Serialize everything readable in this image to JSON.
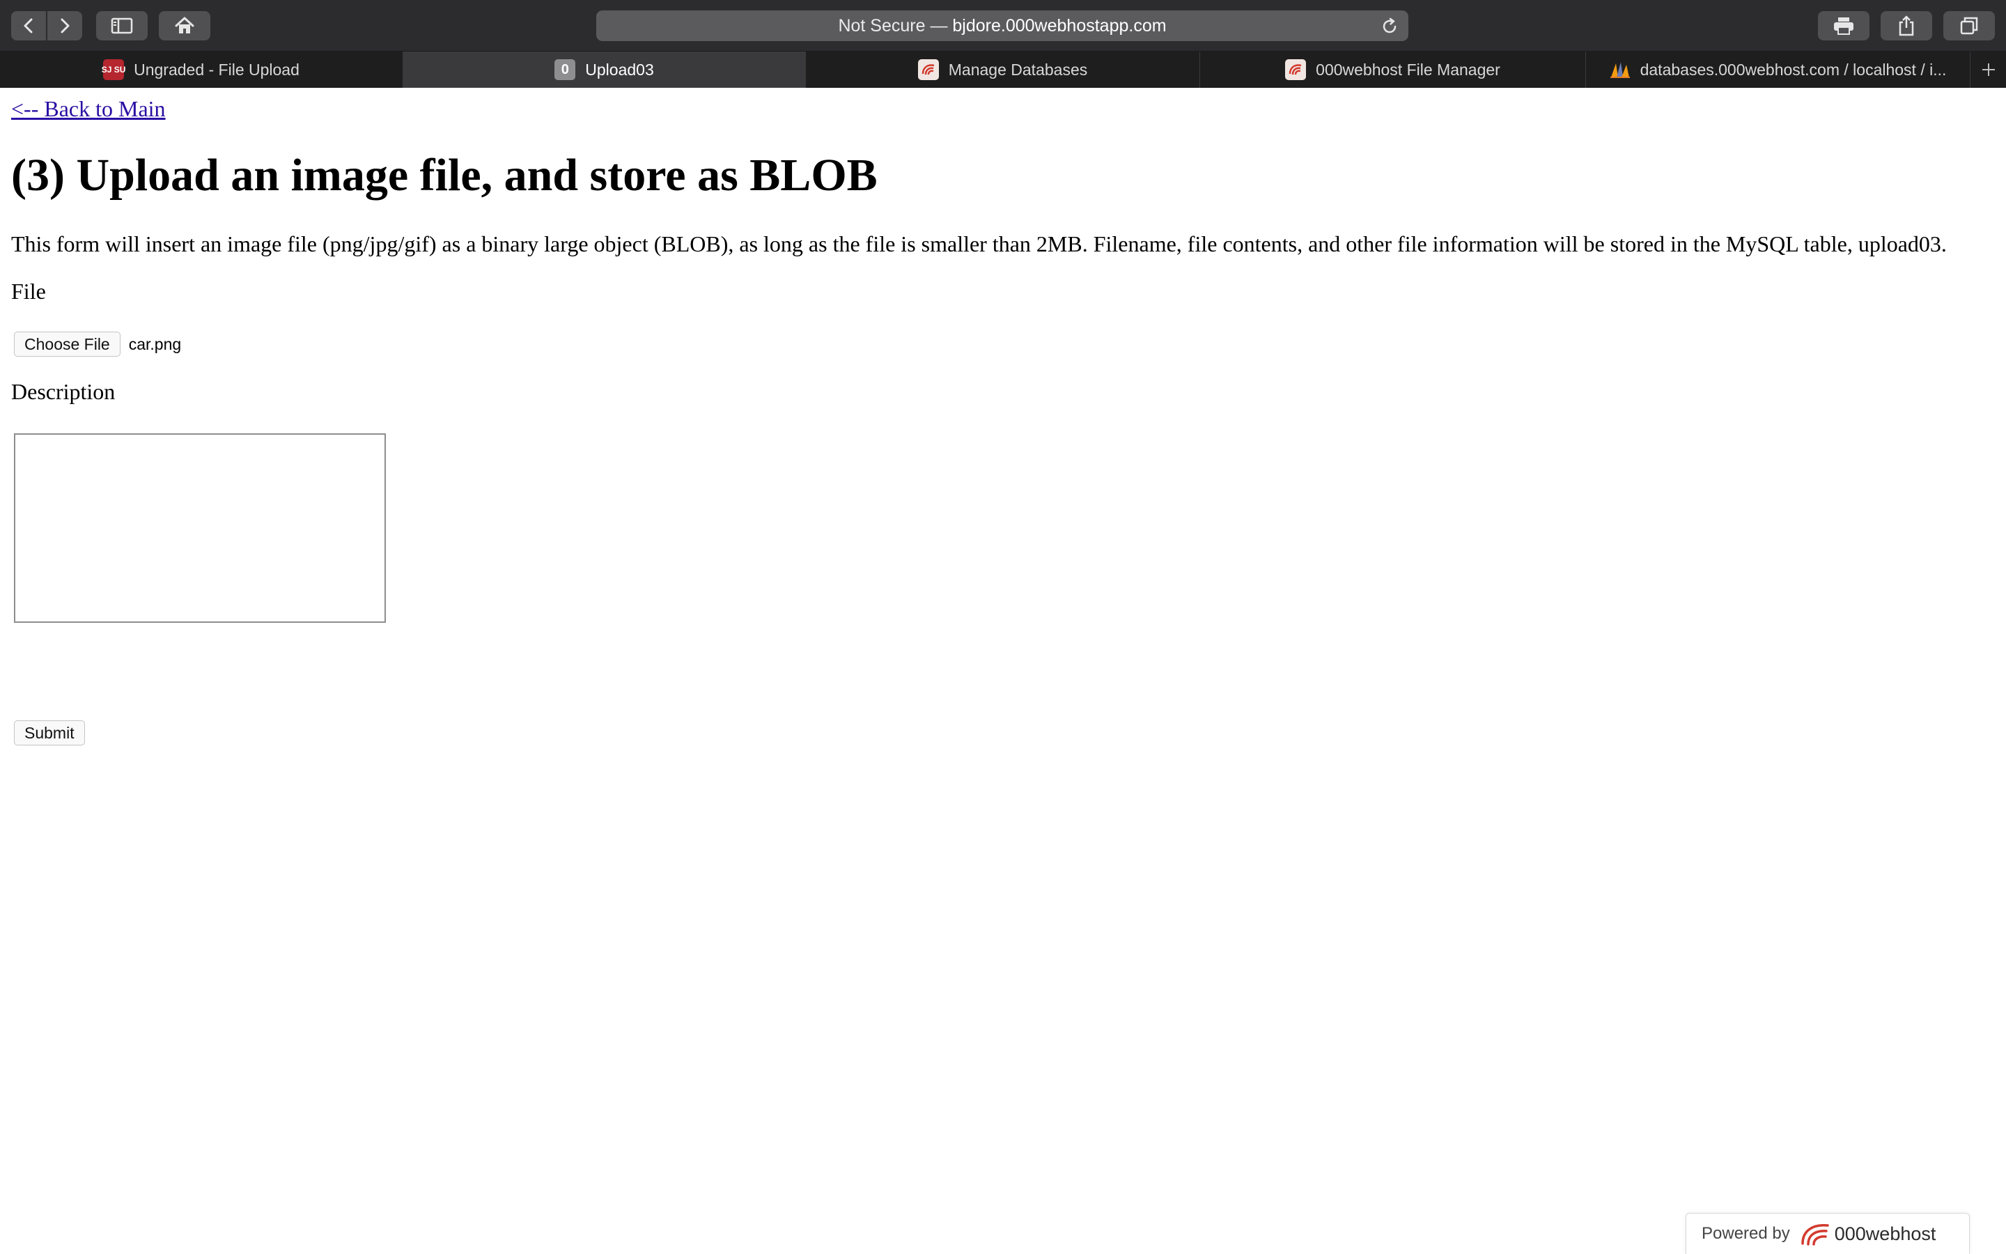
{
  "browser": {
    "address": {
      "security": "Not Secure —",
      "domain": "bjdore.000webhostapp.com"
    },
    "tabs": [
      {
        "label": "Ungraded - File Upload",
        "favicon": "sjsu-icon",
        "active": false
      },
      {
        "label": "Upload03",
        "favicon": "zero-icon",
        "favicon_text": "0",
        "active": true
      },
      {
        "label": "Manage Databases",
        "favicon": "000webhost-icon",
        "active": false
      },
      {
        "label": "000webhost File Manager",
        "favicon": "000webhost-icon",
        "active": false
      },
      {
        "label": "databases.000webhost.com / localhost / i...",
        "favicon": "phpmyadmin-icon",
        "active": false
      }
    ],
    "sjsu_favicon_text": "SJ SU",
    "colors": {
      "toolbar": "#2c2c2e",
      "tabbar": "#1e1e1f",
      "active_tab": "#3a3a3c"
    }
  },
  "page": {
    "back_link": "<-- Back to Main",
    "title": "(3) Upload an image file, and store as BLOB",
    "description": "This form will insert an image file (png/jpg/gif) as a binary large object (BLOB), as long as the file is smaller than 2MB. Filename, file contents, and other file information will be stored in the MySQL table, upload03.",
    "file_label": "File",
    "choose_file_label": "Choose File",
    "chosen_file": "car.png",
    "description_label": "Description",
    "description_value": "",
    "submit_label": "Submit",
    "link_color": "#2a0ea3"
  },
  "footer_badge": {
    "powered_by": "Powered by",
    "brand": "000webhost"
  }
}
